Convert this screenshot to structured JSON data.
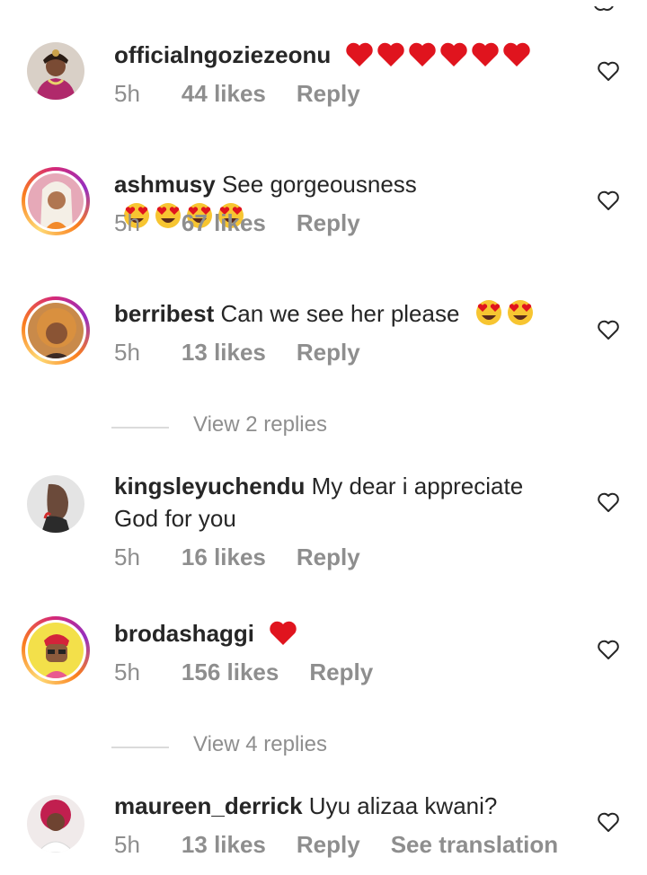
{
  "colors": {
    "text_primary": "#262626",
    "text_secondary": "#8e8e8e",
    "divider": "#dbdbdb",
    "heart_red": "#e0141e"
  },
  "comments": [
    {
      "username": "officialngoziezeonu",
      "text": "",
      "emojis": [
        "red-heart",
        "red-heart",
        "red-heart",
        "red-heart",
        "red-heart",
        "red-heart"
      ],
      "time": "5h",
      "likes": "44 likes",
      "reply": "Reply",
      "avatar": "woman-with-headdress",
      "story_ring": false
    },
    {
      "username": "ashmusy",
      "text": "See gorgeousness",
      "emojis": [
        "heart-eyes",
        "heart-eyes",
        "heart-eyes",
        "heart-eyes"
      ],
      "time": "5h",
      "likes": "67 likes",
      "reply": "Reply",
      "avatar": "woman-blonde-hair",
      "story_ring": true
    },
    {
      "username": "berribest",
      "text": "Can we see her please",
      "emojis": [
        "heart-eyes",
        "heart-eyes"
      ],
      "time": "5h",
      "likes": "13 likes",
      "reply": "Reply",
      "avatar": "woman-curly-hair",
      "story_ring": true
    },
    {
      "username": "kingsleyuchendu",
      "text": "My dear i appreciate God for you",
      "emojis": [],
      "time": "5h",
      "likes": "16 likes",
      "reply": "Reply",
      "avatar": "man-profile",
      "story_ring": false
    },
    {
      "username": "brodashaggi",
      "text": "",
      "emojis": [
        "red-heart"
      ],
      "time": "5h",
      "likes": "156 likes",
      "reply": "Reply",
      "avatar": "cartoon-character",
      "story_ring": true
    },
    {
      "username": "maureen_derrick",
      "text": "Uyu alizaa kwani?",
      "emojis": [],
      "time": "5h",
      "likes": "13 likes",
      "reply": "Reply",
      "see_translation": "See translation",
      "avatar": "woman-red-hair",
      "story_ring": false
    }
  ],
  "view_replies": [
    {
      "label": "View 2 replies"
    },
    {
      "label": "View 4 replies"
    }
  ]
}
